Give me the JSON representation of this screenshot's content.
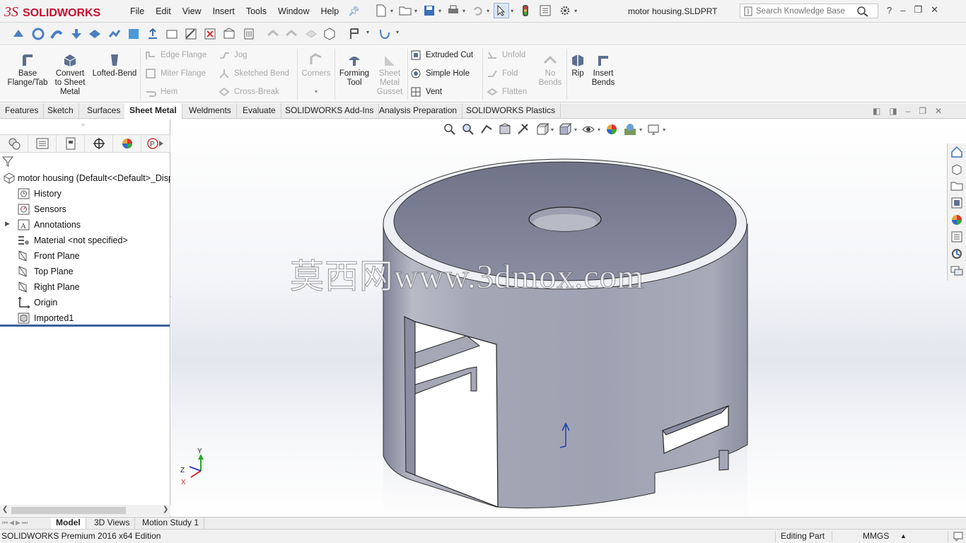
{
  "app": {
    "brand": "SOLIDWORKS",
    "document_title": "motor housing.SLDPRT"
  },
  "menu": [
    "File",
    "Edit",
    "View",
    "Insert",
    "Tools",
    "Window",
    "Help"
  ],
  "search": {
    "placeholder": "Search Knowledge Base"
  },
  "command_manager": {
    "big_buttons": [
      {
        "label": "Base\nFlange/Tab",
        "icon": "base-flange-icon",
        "enabled": true
      },
      {
        "label": "Convert\nto Sheet\nMetal",
        "icon": "convert-sheet-metal-icon",
        "enabled": true
      },
      {
        "label": "Lofted-Bend",
        "icon": "lofted-bend-icon",
        "enabled": true
      },
      {
        "label": "Corners",
        "icon": "corners-icon",
        "enabled": false
      },
      {
        "label": "Forming\nTool",
        "icon": "forming-tool-icon",
        "enabled": true
      },
      {
        "label": "Sheet\nMetal\nGusset",
        "icon": "gusset-icon",
        "enabled": false
      },
      {
        "label": "No\nBends",
        "icon": "no-bends-icon",
        "enabled": false
      },
      {
        "label": "Rip",
        "icon": "rip-icon",
        "enabled": true
      },
      {
        "label": "Insert\nBends",
        "icon": "insert-bends-icon",
        "enabled": true
      }
    ],
    "small_buttons": {
      "edge_flange": "Edge Flange",
      "miter_flange": "Miter Flange",
      "hem": "Hem",
      "jog": "Jog",
      "sketched_bend": "Sketched Bend",
      "cross_break": "Cross-Break",
      "extruded_cut": "Extruded Cut",
      "simple_hole": "Simple Hole",
      "vent": "Vent",
      "unfold": "Unfold",
      "fold": "Fold",
      "flatten": "Flatten"
    }
  },
  "tabs": [
    "Features",
    "Sketch",
    "Surfaces",
    "Sheet Metal",
    "Weldments",
    "Evaluate",
    "SOLIDWORKS Add-Ins",
    "Analysis Preparation",
    "SOLIDWORKS Plastics"
  ],
  "active_tab": "Sheet Metal",
  "feature_tree": {
    "root": "motor housing  (Default<<Default>_Disp",
    "items": [
      {
        "label": "History",
        "icon": "history-icon",
        "expandable": false
      },
      {
        "label": "Sensors",
        "icon": "sensors-icon",
        "expandable": false
      },
      {
        "label": "Annotations",
        "icon": "annotations-icon",
        "expandable": true
      },
      {
        "label": "Material <not specified>",
        "icon": "material-icon",
        "expandable": false
      },
      {
        "label": "Front Plane",
        "icon": "plane-icon",
        "expandable": false
      },
      {
        "label": "Top Plane",
        "icon": "plane-icon",
        "expandable": false
      },
      {
        "label": "Right Plane",
        "icon": "plane-icon",
        "expandable": false
      },
      {
        "label": "Origin",
        "icon": "origin-icon",
        "expandable": false
      },
      {
        "label": "Imported1",
        "icon": "imported-body-icon",
        "expandable": false
      }
    ]
  },
  "viewport": {
    "watermark": "莫西网www.3dmox.com",
    "triad_labels": {
      "x": "X",
      "y": "Y",
      "z": "Z"
    }
  },
  "bottom_tabs": [
    "Model",
    "3D Views",
    "Motion Study 1"
  ],
  "active_bottom_tab": "Model",
  "status": {
    "edition": "SOLIDWORKS Premium 2016 x64 Edition",
    "mode": "Editing Part",
    "units": "MMGS"
  },
  "colors": {
    "accent_red": "#c8102e",
    "selection_blue": "#3a5f9a",
    "part_gray": "#a9abb9"
  }
}
